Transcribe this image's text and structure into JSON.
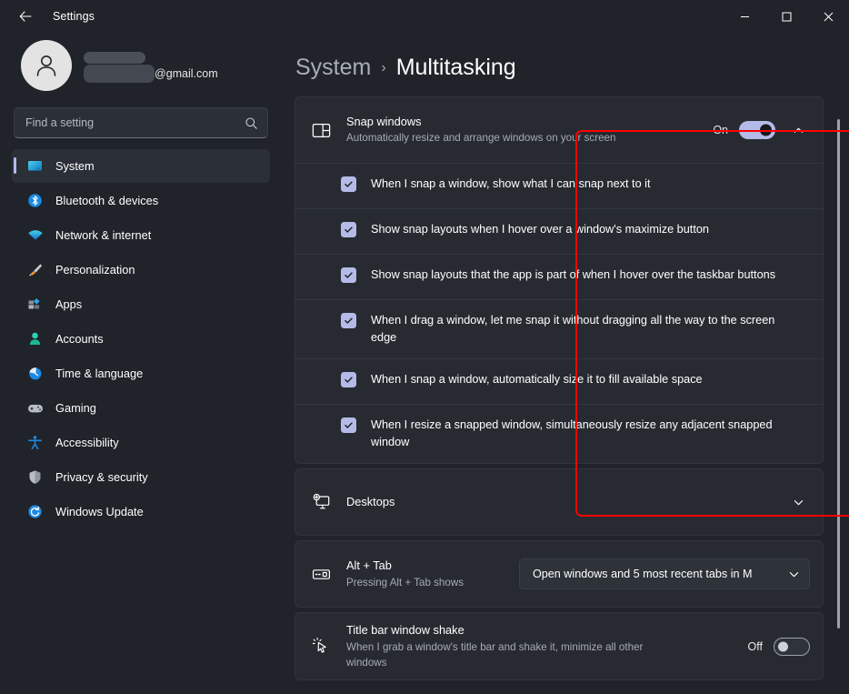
{
  "window": {
    "title": "Settings",
    "back_icon": "back-arrow-icon",
    "minimize_label": "Minimize",
    "maximize_label": "Maximize",
    "close_label": "Close"
  },
  "profile": {
    "name_redacted": "",
    "email_suffix": "@gmail.com",
    "avatar_icon": "user-avatar-icon"
  },
  "search": {
    "placeholder": "Find a setting",
    "value": "",
    "icon": "search-icon"
  },
  "sidebar": {
    "items": [
      {
        "label": "System",
        "icon": "monitor-icon",
        "active": true
      },
      {
        "label": "Bluetooth & devices",
        "icon": "bluetooth-icon",
        "active": false
      },
      {
        "label": "Network & internet",
        "icon": "wifi-icon",
        "active": false
      },
      {
        "label": "Personalization",
        "icon": "paintbrush-icon",
        "active": false
      },
      {
        "label": "Apps",
        "icon": "apps-icon",
        "active": false
      },
      {
        "label": "Accounts",
        "icon": "person-icon",
        "active": false
      },
      {
        "label": "Time & language",
        "icon": "clock-icon",
        "active": false
      },
      {
        "label": "Gaming",
        "icon": "gamepad-icon",
        "active": false
      },
      {
        "label": "Accessibility",
        "icon": "accessibility-icon",
        "active": false
      },
      {
        "label": "Privacy & security",
        "icon": "shield-icon",
        "active": false
      },
      {
        "label": "Windows Update",
        "icon": "update-icon",
        "active": false
      }
    ]
  },
  "breadcrumb": {
    "parent": "System",
    "separator": "›",
    "current": "Multitasking"
  },
  "snap_windows": {
    "title": "Snap windows",
    "subtitle": "Automatically resize and arrange windows on your screen",
    "icon": "snap-layout-icon",
    "toggle_state": "On",
    "expanded": true,
    "chevron_icon": "chevron-up-icon",
    "options": [
      {
        "label": "When I snap a window, show what I can snap next to it",
        "checked": true
      },
      {
        "label": "Show snap layouts when I hover over a window's maximize button",
        "checked": true
      },
      {
        "label": "Show snap layouts that the app is part of when I hover over the taskbar buttons",
        "checked": true
      },
      {
        "label": "When I drag a window, let me snap it without dragging all the way to the screen edge",
        "checked": true
      },
      {
        "label": "When I snap a window, automatically size it to fill available space",
        "checked": true
      },
      {
        "label": "When I resize a snapped window, simultaneously resize any adjacent snapped window",
        "checked": true
      }
    ]
  },
  "desktops": {
    "title": "Desktops",
    "icon": "desktops-icon",
    "chevron_icon": "chevron-down-icon"
  },
  "alt_tab": {
    "title": "Alt + Tab",
    "subtitle": "Pressing Alt + Tab shows",
    "icon": "keyboard-key-icon",
    "selected_option": "Open windows and 5 most recent tabs in M",
    "chevron_icon": "chevron-down-icon"
  },
  "title_bar_shake": {
    "title": "Title bar window shake",
    "subtitle": "When I grab a window's title bar and shake it, minimize all other windows",
    "icon": "cursor-shake-icon",
    "toggle_state": "Off"
  },
  "colors": {
    "accent": "#b4bbe8",
    "annotation": "#fe0000",
    "background": "#202329",
    "card": "#272b31"
  }
}
